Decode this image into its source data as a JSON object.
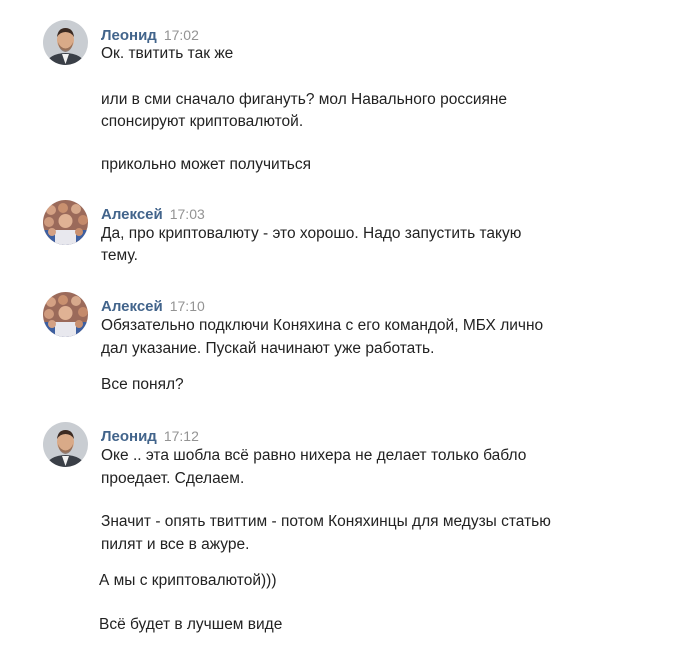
{
  "messages": [
    {
      "author": "Леонид",
      "time": "17:02",
      "avatar": "leonid-avatar",
      "lines": [
        "Ок. твитить так же",
        "или в сми сначало фигануть? мол Навального россияне",
        "спонсируют криптовалютой.",
        "прикольно может получиться"
      ]
    },
    {
      "author": "Алексей",
      "time": "17:03",
      "avatar": "aleksey-avatar",
      "lines": [
        "Да, про криптовалюту - это хорошо. Надо запустить такую",
        "тему."
      ]
    },
    {
      "author": "Алексей",
      "time": "17:10",
      "avatar": "aleksey-avatar",
      "lines": [
        "Обязательно подключи Коняхина с его командой, МБХ лично",
        "дал указание. Пускай начинают уже работать.",
        "Все понял?"
      ]
    },
    {
      "author": "Леонид",
      "time": "17:12",
      "avatar": "leonid-avatar",
      "lines": [
        "Оке .. эта шобла всё равно нихера не делает только бабло",
        "проедает. Сделаем.",
        "Значит - опять твиттим - потом Коняхинцы для медузы статью",
        "пилят и все в ажуре.",
        "А мы с криптовалютой)))",
        "Всё будет в лучшем виде"
      ]
    }
  ]
}
